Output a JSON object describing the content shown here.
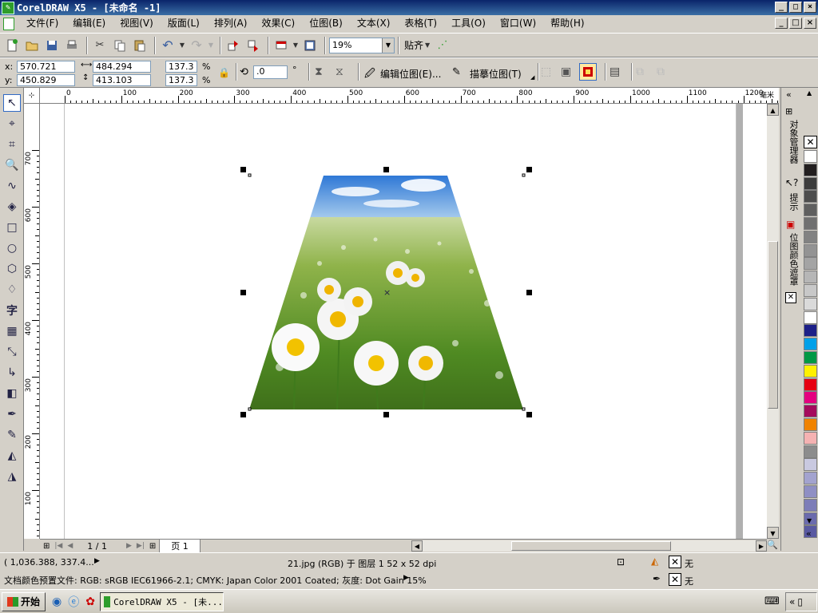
{
  "window": {
    "title": "CorelDRAW X5 - [未命名 -1]",
    "buttons": [
      "_",
      "□",
      "×"
    ]
  },
  "menu": {
    "items": [
      "文件(F)",
      "编辑(E)",
      "视图(V)",
      "版面(L)",
      "排列(A)",
      "效果(C)",
      "位图(B)",
      "文本(X)",
      "表格(T)",
      "工具(O)",
      "窗口(W)",
      "帮助(H)"
    ]
  },
  "standard_toolbar": {
    "zoom_value": "19%",
    "snap_label": "贴齐"
  },
  "property_bar": {
    "x_label": "x:",
    "x_value": "570.721 mm",
    "y_label": "y:",
    "y_value": "450.829 mm",
    "width_value": "484.294 mm",
    "height_value": "413.103 mm",
    "scale_x": "137.3",
    "scale_y": "137.3",
    "percent_symbol": "%",
    "rotation_value": ".0",
    "degree_symbol": "°",
    "edit_bitmap_label": "编辑位图(E)...",
    "trace_bitmap_label": "描摹位图(T)"
  },
  "ruler": {
    "unit": "毫米",
    "h_ticks": [
      "0",
      "100",
      "200",
      "300",
      "400",
      "500",
      "600",
      "700",
      "800",
      "900",
      "1000",
      "1100",
      "1200"
    ],
    "v_ticks": [
      "700",
      "600",
      "500",
      "400",
      "300",
      "200",
      "100"
    ]
  },
  "dockers": {
    "object_manager": "对象管理器",
    "hints": "提示",
    "bitmap_color_mask": "位图颜色遮罩"
  },
  "palette": {
    "colors": [
      "#ffffff",
      "#231f20",
      "#3c3c3c",
      "#4d4d4d",
      "#5f5f5f",
      "#707070",
      "#828282",
      "#939393",
      "#a4a4a4",
      "#b6b6b6",
      "#c8c8c8",
      "#dadada",
      "#ffffff",
      "#1d2088",
      "#00a0e9",
      "#009944",
      "#fff100",
      "#e60012",
      "#e4007f",
      "#a40b5d",
      "#f08300",
      "#f5b2b2",
      "#8c8c8c",
      "#c9c9e0",
      "#a3a3cf",
      "#8f8fc4",
      "#7d7db8",
      "#6b6bad",
      "#5959a1"
    ]
  },
  "page_nav": {
    "page_counter": "1 / 1",
    "page_tab": "页 1"
  },
  "status": {
    "cursor_coords": "( 1,036.388, 337.4...",
    "object_info": "21.jpg (RGB) 于 图层 1 52 x 52 dpi",
    "fill_label": "无",
    "outline_label": "无",
    "color_profile": "文档颜色预置文件: RGB: sRGB IEC61966-2.1; CMYK: Japan Color 2001 Coated; 灰度: Dot Gain 15%"
  },
  "taskbar": {
    "start_label": "开始",
    "task_label": "CorelDRAW X5 - [未..."
  },
  "icons": [
    "new-icon",
    "open-icon",
    "save-icon",
    "print-icon",
    "cut-icon",
    "copy-icon",
    "paste-icon",
    "undo-icon",
    "redo-icon",
    "import-icon",
    "export-icon",
    "app-launcher-icon",
    "welcome-icon",
    "pick-tool-icon",
    "shape-tool-icon",
    "crop-tool-icon",
    "zoom-tool-icon",
    "freehand-tool-icon",
    "smart-fill-icon",
    "rectangle-tool-icon",
    "ellipse-tool-icon",
    "polygon-tool-icon",
    "basic-shapes-icon",
    "text-tool-icon",
    "table-tool-icon",
    "dimension-tool-icon",
    "connector-tool-icon",
    "blend-tool-icon",
    "eyedropper-tool-icon",
    "outline-pen-icon",
    "fill-tool-icon",
    "interactive-fill-icon"
  ]
}
